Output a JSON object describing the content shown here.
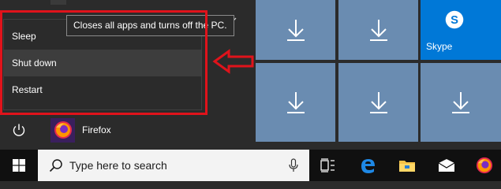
{
  "start_menu": {
    "power_flyout": {
      "items": [
        {
          "label": "Sleep"
        },
        {
          "label": "Shut down"
        },
        {
          "label": "Restart"
        }
      ],
      "tooltip": "Closes all apps and turns off the PC."
    },
    "apps": [
      {
        "label": "Firefox",
        "icon": "firefox-icon"
      }
    ],
    "power_icon": "power-icon"
  },
  "tiles": [
    {
      "type": "download",
      "icon": "download-arrow-icon"
    },
    {
      "type": "download",
      "icon": "download-arrow-icon"
    },
    {
      "type": "app",
      "label": "Skype",
      "icon": "skype-icon"
    },
    {
      "type": "download",
      "icon": "download-arrow-icon"
    },
    {
      "type": "download",
      "icon": "download-arrow-icon"
    },
    {
      "type": "download",
      "icon": "download-arrow-icon"
    }
  ],
  "taskbar": {
    "search_placeholder": "Type here to search",
    "icons": [
      "windows-start-icon",
      "search-icon",
      "microphone-icon",
      "task-view-icon",
      "edge-icon",
      "file-explorer-icon",
      "mail-icon",
      "firefox-icon"
    ]
  },
  "colors": {
    "annotation_red": "#e0131b",
    "tile_blue_gray": "#6a8cb1",
    "skype_blue": "#0078d7",
    "taskbar": "#101010",
    "menu_bg": "#2b2b2b"
  }
}
